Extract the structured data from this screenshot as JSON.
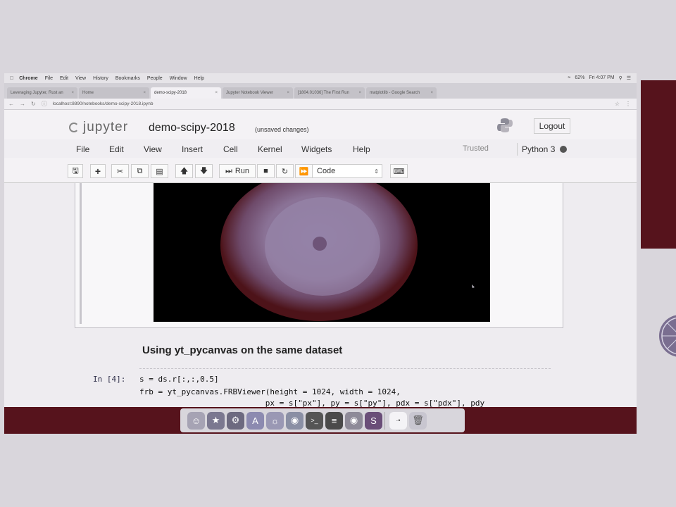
{
  "menubar": {
    "app": "Chrome",
    "items": [
      "File",
      "Edit",
      "View",
      "History",
      "Bookmarks",
      "People",
      "Window",
      "Help"
    ],
    "battery": "62%",
    "clock": "Fri 4:07 PM"
  },
  "tabs": [
    {
      "label": "Leveraging Jupyter, Rust an"
    },
    {
      "label": "Home"
    },
    {
      "label": "demo-scipy-2018"
    },
    {
      "label": "Jupyter Notebook Viewer"
    },
    {
      "label": "[1804.01036] The First Run"
    },
    {
      "label": "matplotlib - Google Search"
    }
  ],
  "address": {
    "url": "localhost:8890/notebooks/demo-scipy-2018.ipynb"
  },
  "jupyter": {
    "logo_text": "jupyter",
    "notebook_title": "demo-scipy-2018",
    "save_status": "(unsaved changes)",
    "logout_label": "Logout",
    "menu": [
      "File",
      "Edit",
      "View",
      "Insert",
      "Cell",
      "Kernel",
      "Widgets",
      "Help"
    ],
    "trusted_label": "Trusted",
    "kernel_label": "Python 3",
    "toolbar": {
      "run_label": "Run",
      "cell_type": "Code"
    }
  },
  "notebook": {
    "heading": "Using yt_pycanvas on the same dataset",
    "prompt": "In [4]:",
    "code_lines": [
      "s = ds.r[:,:,0.5]",
      "frb = yt_pycanvas.FRBViewer(height = 1024, width = 1024,",
      "                           px = s[\"px\"], py = s[\"py\"], pdx = s[\"pdx\"], pdy"
    ]
  },
  "colors": {
    "plot_background": "#4d1319",
    "plot_foreground": "#8a7296",
    "slide_accent": "#56131c"
  }
}
